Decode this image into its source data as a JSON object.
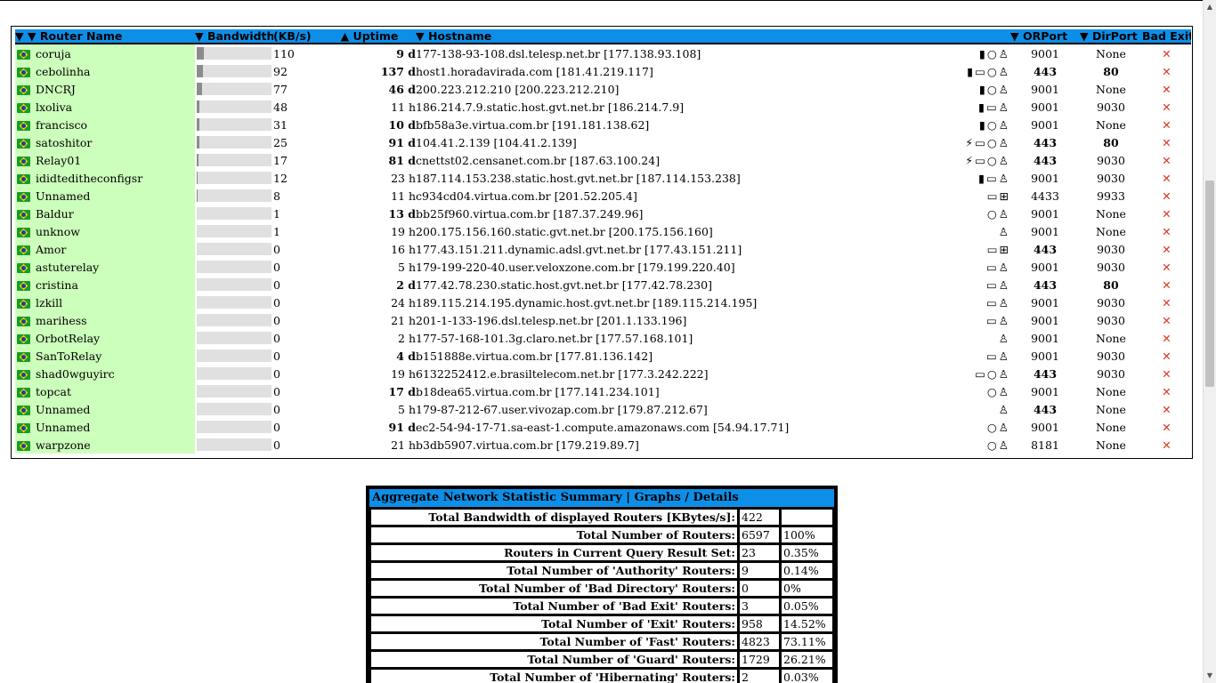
{
  "table": {
    "headers": {
      "router_name": "▼ ▼ Router Name",
      "bandwidth": "▼ Bandwidth",
      "kbs": "(KB/s)",
      "uptime": "▲ Uptime",
      "hostname": "▼ Hostname",
      "orport": "▼ ORPort",
      "dirport": "▼ DirPort",
      "badexit": "Bad Exit"
    },
    "rows": [
      {
        "name": "coruja",
        "bandwidth_fraction": 0.09,
        "kbs": "110",
        "uptime": "9 d",
        "host": "177-138-93-108.dsl.telesp.net.br [177.138.93.108]",
        "flags": "▮○♙",
        "orport": "9001",
        "dirport": "None",
        "badexit": "✕"
      },
      {
        "name": "cebolinha",
        "bandwidth_fraction": 0.08,
        "kbs": "92",
        "uptime": "137 d",
        "host": "host1.horadavirada.com [181.41.219.117]",
        "flags": "▮▭○♙",
        "orport": "443",
        "dirport": "80",
        "badexit": "✕"
      },
      {
        "name": "DNCRJ",
        "bandwidth_fraction": 0.07,
        "kbs": "77",
        "uptime": "46 d",
        "host": "200.223.212.210 [200.223.212.210]",
        "flags": "▮○♙",
        "orport": "9001",
        "dirport": "None",
        "badexit": "✕"
      },
      {
        "name": "lxoliva",
        "bandwidth_fraction": 0.04,
        "kbs": "48",
        "uptime": "11 h",
        "host": "186.214.7.9.static.host.gvt.net.br [186.214.7.9]",
        "flags": "▮▭♙",
        "orport": "9001",
        "dirport": "9030",
        "badexit": "✕"
      },
      {
        "name": "francisco",
        "bandwidth_fraction": 0.03,
        "kbs": "31",
        "uptime": "10 d",
        "host": "bfb58a3e.virtua.com.br [191.181.138.62]",
        "flags": "▮○♙",
        "orport": "9001",
        "dirport": "None",
        "badexit": "✕"
      },
      {
        "name": "satoshitor",
        "bandwidth_fraction": 0.025,
        "kbs": "25",
        "uptime": "91 d",
        "host": "104.41.2.139 [104.41.2.139]",
        "flags": "⚡▭○♙",
        "orport": "443",
        "dirport": "80",
        "badexit": "✕"
      },
      {
        "name": "Relay01",
        "bandwidth_fraction": 0.018,
        "kbs": "17",
        "uptime": "81 d",
        "host": "cnettst02.censanet.com.br [187.63.100.24]",
        "flags": "⚡▭○♙",
        "orport": "443",
        "dirport": "9030",
        "badexit": "✕"
      },
      {
        "name": "ididteditheconfigsr",
        "bandwidth_fraction": 0.012,
        "kbs": "12",
        "uptime": "23 h",
        "host": "187.114.153.238.static.host.gvt.net.br [187.114.153.238]",
        "flags": "▮▭♙",
        "orport": "9001",
        "dirport": "9030",
        "badexit": "✕"
      },
      {
        "name": "Unnamed",
        "bandwidth_fraction": 0.008,
        "kbs": "8",
        "uptime": "11 h",
        "host": "c934cd04.virtua.com.br [201.52.205.4]",
        "flags": "▭⊞",
        "orport": "4433",
        "dirport": "9933",
        "badexit": "✕"
      },
      {
        "name": "Baldur",
        "bandwidth_fraction": 0.0,
        "kbs": "1",
        "uptime": "13 d",
        "host": "bb25f960.virtua.com.br [187.37.249.96]",
        "flags": "○♙",
        "orport": "9001",
        "dirport": "None",
        "badexit": "✕"
      },
      {
        "name": "unknow",
        "bandwidth_fraction": 0.0,
        "kbs": "1",
        "uptime": "19 h",
        "host": "200.175.156.160.static.gvt.net.br [200.175.156.160]",
        "flags": "♙",
        "orport": "9001",
        "dirport": "None",
        "badexit": "✕"
      },
      {
        "name": "Amor",
        "bandwidth_fraction": 0.0,
        "kbs": "0",
        "uptime": "16 h",
        "host": "177.43.151.211.dynamic.adsl.gvt.net.br [177.43.151.211]",
        "flags": "▭⊞",
        "orport": "443",
        "dirport": "9030",
        "badexit": "✕"
      },
      {
        "name": "astuterelay",
        "bandwidth_fraction": 0.0,
        "kbs": "0",
        "uptime": "5 h",
        "host": "179-199-220-40.user.veloxzone.com.br [179.199.220.40]",
        "flags": "▭♙",
        "orport": "9001",
        "dirport": "9030",
        "badexit": "✕"
      },
      {
        "name": "cristina",
        "bandwidth_fraction": 0.0,
        "kbs": "0",
        "uptime": "2 d",
        "host": "177.42.78.230.static.host.gvt.net.br [177.42.78.230]",
        "flags": "▭♙",
        "orport": "443",
        "dirport": "80",
        "badexit": "✕"
      },
      {
        "name": "lzkill",
        "bandwidth_fraction": 0.0,
        "kbs": "0",
        "uptime": "24 h",
        "host": "189.115.214.195.dynamic.host.gvt.net.br [189.115.214.195]",
        "flags": "▭♙",
        "orport": "9001",
        "dirport": "9030",
        "badexit": "✕"
      },
      {
        "name": "marihess",
        "bandwidth_fraction": 0.0,
        "kbs": "0",
        "uptime": "21 h",
        "host": "201-1-133-196.dsl.telesp.net.br [201.1.133.196]",
        "flags": "▭♙",
        "orport": "9001",
        "dirport": "9030",
        "badexit": "✕"
      },
      {
        "name": "OrbotRelay",
        "bandwidth_fraction": 0.0,
        "kbs": "0",
        "uptime": "2 h",
        "host": "177-57-168-101.3g.claro.net.br [177.57.168.101]",
        "flags": "♙",
        "orport": "9001",
        "dirport": "None",
        "badexit": "✕"
      },
      {
        "name": "SanToRelay",
        "bandwidth_fraction": 0.0,
        "kbs": "0",
        "uptime": "4 d",
        "host": "b151888e.virtua.com.br [177.81.136.142]",
        "flags": "▭♙",
        "orport": "9001",
        "dirport": "9030",
        "badexit": "✕"
      },
      {
        "name": "shad0wguyirc",
        "bandwidth_fraction": 0.0,
        "kbs": "0",
        "uptime": "19 h",
        "host": "6132252412.e.brasiltelecom.net.br [177.3.242.222]",
        "flags": "▭○♙",
        "orport": "443",
        "dirport": "9030",
        "badexit": "✕"
      },
      {
        "name": "topcat",
        "bandwidth_fraction": 0.0,
        "kbs": "0",
        "uptime": "17 d",
        "host": "b18dea65.virtua.com.br [177.141.234.101]",
        "flags": "○♙",
        "orport": "9001",
        "dirport": "None",
        "badexit": "✕"
      },
      {
        "name": "Unnamed",
        "bandwidth_fraction": 0.0,
        "kbs": "0",
        "uptime": "5 h",
        "host": "179-87-212-67.user.vivozap.com.br [179.87.212.67]",
        "flags": "♙",
        "orport": "443",
        "dirport": "None",
        "badexit": "✕"
      },
      {
        "name": "Unnamed",
        "bandwidth_fraction": 0.0,
        "kbs": "0",
        "uptime": "91 d",
        "host": "ec2-54-94-17-71.sa-east-1.compute.amazonaws.com [54.94.17.71]",
        "flags": "○♙",
        "orport": "9001",
        "dirport": "None",
        "badexit": "✕"
      },
      {
        "name": "warpzone",
        "bandwidth_fraction": 0.0,
        "kbs": "0",
        "uptime": "21 h",
        "host": "b3db5907.virtua.com.br [179.219.89.7]",
        "flags": "○♙",
        "orport": "8181",
        "dirport": "None",
        "badexit": "✕"
      }
    ]
  },
  "summary": {
    "title": "Aggregate Network Statistic Summary | Graphs / Details",
    "rows": [
      {
        "label": "Total Bandwidth of displayed Routers [KBytes/s]:",
        "value": "422",
        "pct": ""
      },
      {
        "label": "Total Number of Routers:",
        "value": "6597",
        "pct": "100%"
      },
      {
        "label": "Routers in Current Query Result Set:",
        "value": "23",
        "pct": "0.35%"
      },
      {
        "label": "Total Number of 'Authority' Routers:",
        "value": "9",
        "pct": "0.14%"
      },
      {
        "label": "Total Number of 'Bad Directory' Routers:",
        "value": "0",
        "pct": "0%"
      },
      {
        "label": "Total Number of 'Bad Exit' Routers:",
        "value": "3",
        "pct": "0.05%"
      },
      {
        "label": "Total Number of 'Exit' Routers:",
        "value": "958",
        "pct": "14.52%"
      },
      {
        "label": "Total Number of 'Fast' Routers:",
        "value": "4823",
        "pct": "73.11%"
      },
      {
        "label": "Total Number of 'Guard' Routers:",
        "value": "1729",
        "pct": "26.21%"
      },
      {
        "label": "Total Number of 'Hibernating' Routers:",
        "value": "2",
        "pct": "0.03%"
      }
    ]
  },
  "scrollbar": {
    "up_icon": "up-arrow-icon",
    "down_icon": "down-arrow-icon"
  },
  "colors": {
    "header_blue": "#0d8fe8",
    "name_green": "#ccffbb",
    "bad_exit_red": "#e03020"
  }
}
